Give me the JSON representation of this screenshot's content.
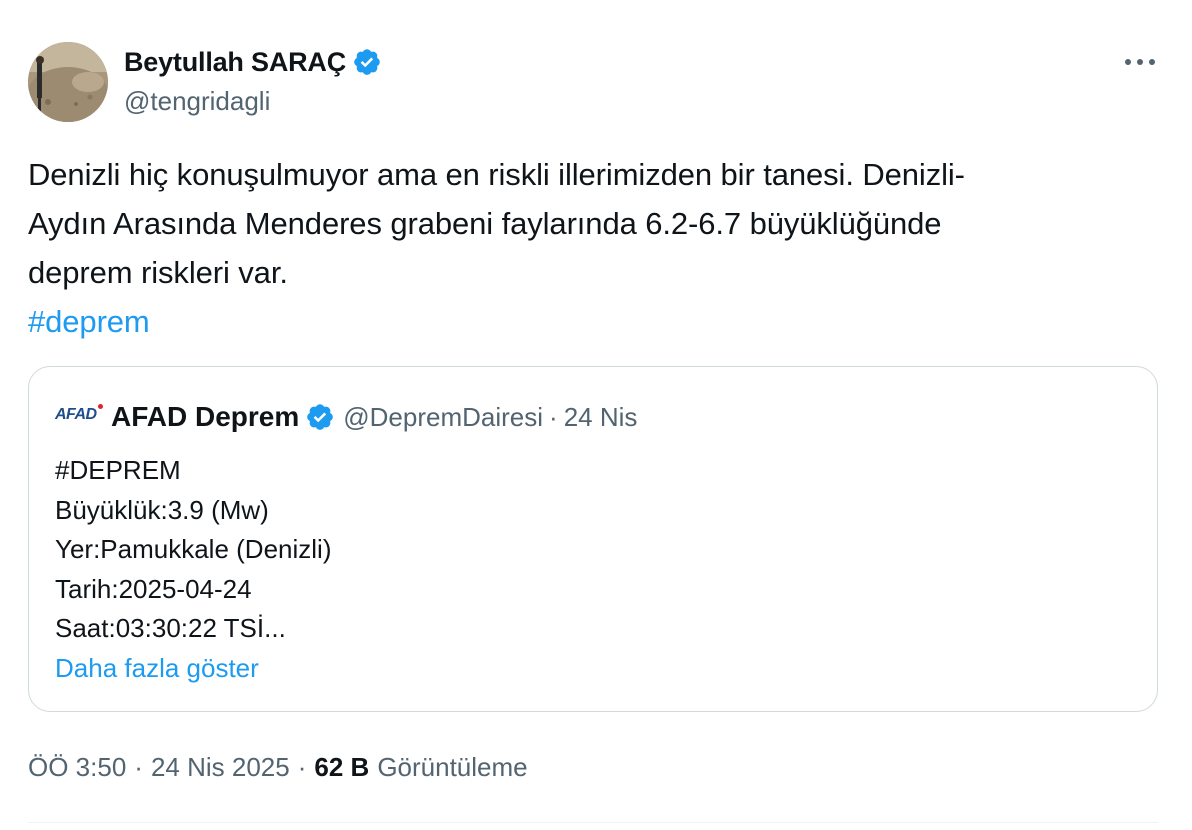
{
  "tweet": {
    "author_name": "Beytullah SARAÇ",
    "author_handle": "@tengridagli",
    "text_lines": [
      "Denizli hiç konuşulmuyor ama en riskli illerimizden bir tanesi. Denizli-",
      "Aydın Arasında Menderes grabeni faylarında 6.2-6.7 büyüklüğünde",
      "deprem riskleri var."
    ],
    "hashtag": "#deprem",
    "time": "ÖÖ 3:50",
    "date": "24 Nis 2025",
    "separator": "·",
    "views_count": "62 B",
    "views_label": "Görüntüleme"
  },
  "quote": {
    "logo_text": "AFAD",
    "author_name": "AFAD Deprem",
    "author_handle": "@DepremDairesi",
    "separator": "·",
    "date": "24 Nis",
    "lines": [
      "#DEPREM",
      "Büyüklük:3.9 (Mw)",
      "Yer:Pamukkale (Denizli)",
      "Tarih:2025-04-24",
      "Saat:03:30:22 TSİ..."
    ],
    "show_more": "Daha fazla göster"
  },
  "icons": {
    "verified": "verified-badge-icon",
    "more": "more-horizontal-icon"
  },
  "colors": {
    "accent": "#1d9bf0",
    "text": "#0f1419",
    "secondary": "#536471",
    "border": "#cfd9de"
  }
}
